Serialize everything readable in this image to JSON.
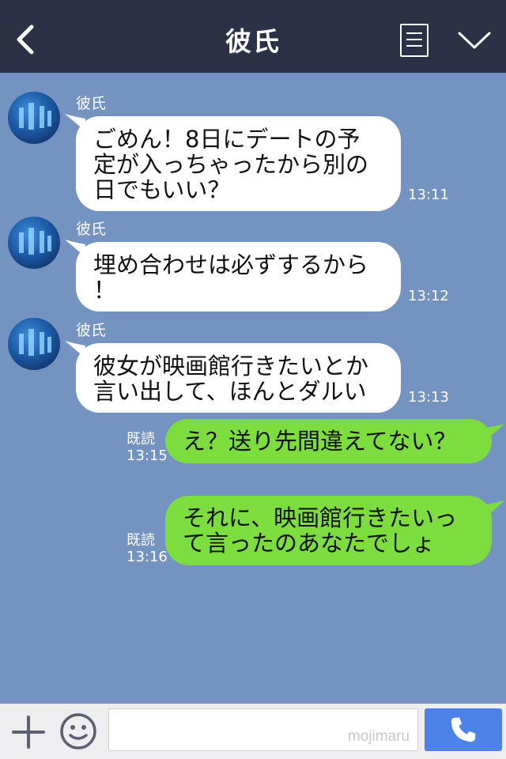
{
  "header": {
    "title": "彼氏",
    "back_icon": "chevron-left-icon",
    "menu_icon": "list-icon",
    "collapse_icon": "chevron-down-icon"
  },
  "messages": [
    {
      "side": "left",
      "sender": "彼氏",
      "lines": [
        "ごめん！8日にデートの予",
        "定が入っちゃったから別の",
        "日でもいい？"
      ],
      "time": "13:11"
    },
    {
      "side": "left",
      "sender": "彼氏",
      "lines": [
        "埋め合わせは必ずするから",
        "！"
      ],
      "time": "13:12"
    },
    {
      "side": "left",
      "sender": "彼氏",
      "lines": [
        "彼女が映画館行きたいとか",
        "言い出して、ほんとダルい"
      ],
      "time": "13:13"
    },
    {
      "side": "right",
      "read": "既読",
      "lines": [
        "え？送り先間違えてない？"
      ],
      "time": "13:15"
    },
    {
      "side": "right",
      "read": "既読",
      "lines": [
        "それに、映画館行きたいっ",
        "て言ったのあなたでしょ"
      ],
      "time": "13:16"
    }
  ],
  "footer": {
    "input_placeholder": "mojimaru",
    "plus_icon": "plus-icon",
    "sticker_icon": "smile-icon",
    "call_icon": "phone-icon"
  },
  "colors": {
    "header_bg": "#2b3246",
    "chat_bg": "#7493c1",
    "outgoing_bubble": "#7ddc3e",
    "incoming_bubble": "#ffffff",
    "call_button": "#4d82e8"
  }
}
